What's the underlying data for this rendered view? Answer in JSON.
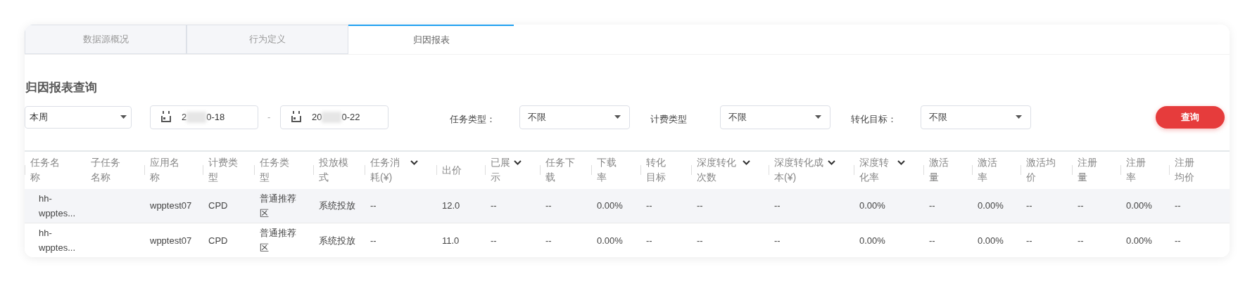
{
  "tabs": [
    {
      "label": "数据源概况",
      "selected": false
    },
    {
      "label": "行为定义",
      "selected": false
    },
    {
      "label": "归因报表",
      "selected": true
    }
  ],
  "section_title": "归因报表查询",
  "filters": {
    "period": {
      "value": "本周"
    },
    "date_start": {
      "prefix": "2",
      "suffix": "0-18"
    },
    "date_separator": "-",
    "date_end": {
      "prefix": "20",
      "suffix": "0-22"
    },
    "selects": [
      {
        "label": "任务类型：",
        "value": "不限"
      },
      {
        "label": "计费类型",
        "value": "不限"
      },
      {
        "label": "转化目标：",
        "value": "不限"
      }
    ],
    "query_button": "查询"
  },
  "table": {
    "columns": [
      {
        "label": "任务名称",
        "sortable": false
      },
      {
        "label": "子任务名称",
        "sortable": false
      },
      {
        "label": "应用名称",
        "sortable": false
      },
      {
        "label": "计费类型",
        "sortable": false
      },
      {
        "label": "任务类型",
        "sortable": false
      },
      {
        "label": "投放模式",
        "sortable": false
      },
      {
        "label": "任务消耗(¥)",
        "sortable": true
      },
      {
        "label": "出价",
        "sortable": false
      },
      {
        "label": "已展示",
        "sortable": true
      },
      {
        "label": "任务下载",
        "sortable": false
      },
      {
        "label": "下载率",
        "sortable": false
      },
      {
        "label": "转化目标",
        "sortable": false
      },
      {
        "label": "深度转化次数",
        "sortable": true
      },
      {
        "label": "深度转化成本(¥)",
        "sortable": true
      },
      {
        "label": "深度转化率",
        "sortable": true
      },
      {
        "label": "激活量",
        "sortable": false
      },
      {
        "label": "激活率",
        "sortable": false
      },
      {
        "label": "激活均价",
        "sortable": false
      },
      {
        "label": "注册量",
        "sortable": false
      },
      {
        "label": "注册率",
        "sortable": false
      },
      {
        "label": "注册均价",
        "sortable": false
      }
    ],
    "rows": [
      {
        "highlighted": true,
        "cells": [
          "hh-wpptes...",
          "",
          "wpptest07",
          "CPD",
          "普通推荐区",
          "系统投放",
          "--",
          "12.0",
          "--",
          "--",
          "0.00%",
          "--",
          "--",
          "--",
          "0.00%",
          "--",
          "0.00%",
          "--",
          "--",
          "0.00%",
          "--"
        ]
      },
      {
        "highlighted": false,
        "cells": [
          "hh-wpptes...",
          "",
          "wpptest07",
          "CPD",
          "普通推荐区",
          "系统投放",
          "--",
          "11.0",
          "--",
          "--",
          "0.00%",
          "--",
          "--",
          "--",
          "0.00%",
          "--",
          "0.00%",
          "--",
          "--",
          "0.00%",
          "--"
        ]
      }
    ]
  }
}
